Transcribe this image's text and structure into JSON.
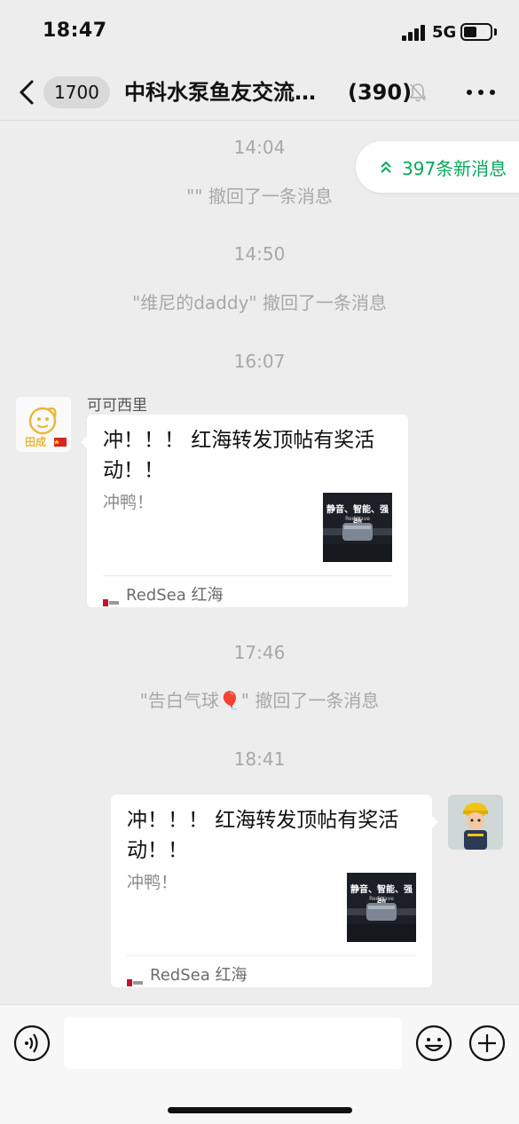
{
  "status_bar": {
    "time": "18:47",
    "network": "5G",
    "battery_level": 0.5
  },
  "nav": {
    "unread_count": "1700",
    "title": "中科水泵鱼友交流…",
    "member_count": "(390)",
    "icons": [
      "back-arrow-icon",
      "mute-bell-icon",
      "more-icon"
    ]
  },
  "new_messages": {
    "label": "397条新消息",
    "icon": "double-chevron-up-icon"
  },
  "messages": [
    {
      "type": "time",
      "text": "14:04"
    },
    {
      "type": "system",
      "text": "\"\" 撤回了一条消息"
    },
    {
      "type": "time",
      "text": "14:50"
    },
    {
      "type": "system",
      "text": "\"维尼的daddy\" 撤回了一条消息"
    },
    {
      "type": "time",
      "text": "16:07"
    },
    {
      "type": "card",
      "side": "left",
      "sender": "可可西里",
      "avatar_text": "田成",
      "title": "冲！！！ 红海转发顶帖有奖活动！！",
      "desc": "冲鸭！",
      "thumb_text": "静音、智能、强劲",
      "thumb_sub": "RedWave",
      "source": "RedSea 红海"
    },
    {
      "type": "time",
      "text": "17:46"
    },
    {
      "type": "system",
      "text": "\"告白气球🎈\" 撤回了一条消息"
    },
    {
      "type": "time",
      "text": "18:41"
    },
    {
      "type": "card",
      "side": "right",
      "title": "冲！！！ 红海转发顶帖有奖活动！！",
      "desc": "冲鸭！",
      "thumb_text": "静音、智能、强劲",
      "thumb_sub": "RedWave",
      "source": "RedSea 红海"
    }
  ],
  "input_bar": {
    "placeholder": "",
    "icons": [
      "voice-icon",
      "emoji-icon",
      "plus-icon"
    ]
  },
  "colors": {
    "background": "#ededed",
    "accent_green": "#07a85c",
    "system_text": "#a8a8a8"
  }
}
